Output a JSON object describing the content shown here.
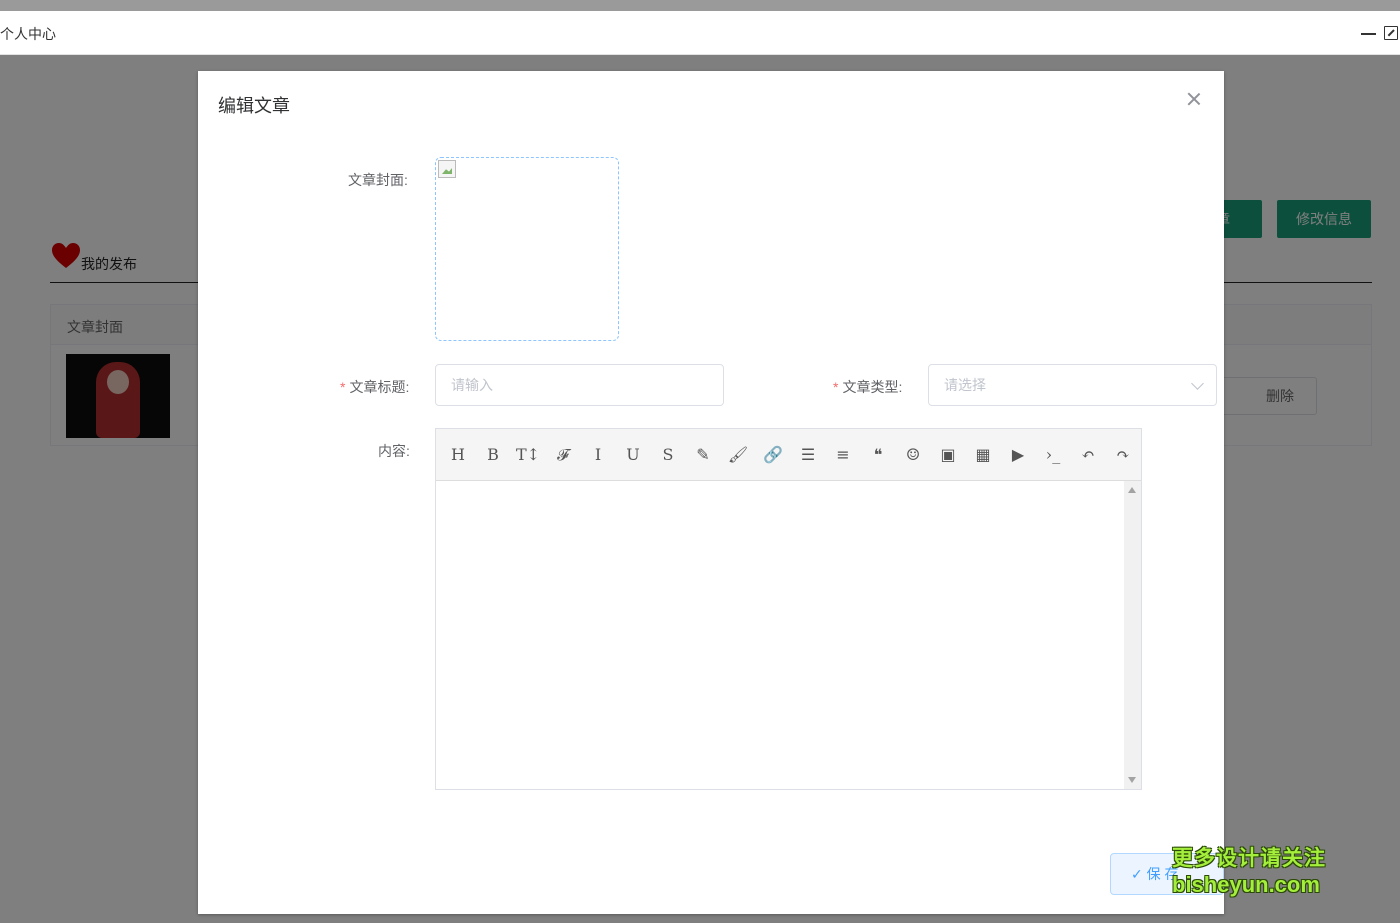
{
  "window": {
    "title": "个人中心"
  },
  "background": {
    "section_title": "我的发布",
    "buttons": {
      "publish": "文章",
      "edit_info": "修改信息"
    },
    "table": {
      "columns": [
        "文章封面"
      ],
      "delete_label": "删除"
    }
  },
  "dialog": {
    "title": "编辑文章",
    "labels": {
      "cover": "文章封面:",
      "title": "文章标题:",
      "type": "文章类型:",
      "content": "内容:"
    },
    "title_input": {
      "placeholder": "请输入",
      "value": ""
    },
    "type_select": {
      "placeholder": "请选择",
      "value": ""
    },
    "editor": {
      "toolbar": [
        {
          "glyph": "H",
          "name": "heading-icon"
        },
        {
          "glyph": "B",
          "name": "bold-icon"
        },
        {
          "glyph": "T↕",
          "name": "font-size-icon"
        },
        {
          "glyph": "𝓕",
          "name": "font-family-icon"
        },
        {
          "glyph": "I",
          "name": "italic-icon"
        },
        {
          "glyph": "U",
          "name": "underline-icon"
        },
        {
          "glyph": "S",
          "name": "strikethrough-icon"
        },
        {
          "glyph": "✎",
          "name": "font-color-icon"
        },
        {
          "glyph": "🖌",
          "name": "background-color-icon"
        },
        {
          "glyph": "🔗",
          "name": "link-icon"
        },
        {
          "glyph": "☰",
          "name": "list-icon"
        },
        {
          "glyph": "≡",
          "name": "align-icon"
        },
        {
          "glyph": "❝",
          "name": "quote-icon"
        },
        {
          "glyph": "☺",
          "name": "emoji-icon"
        },
        {
          "glyph": "▣",
          "name": "image-icon"
        },
        {
          "glyph": "▦",
          "name": "table-icon"
        },
        {
          "glyph": "▶",
          "name": "video-icon"
        },
        {
          "glyph": "›_",
          "name": "code-icon"
        },
        {
          "glyph": "↶",
          "name": "undo-icon"
        },
        {
          "glyph": "↷",
          "name": "redo-icon"
        }
      ]
    },
    "save_label": "保 存"
  },
  "watermark": {
    "line1": "更多设计请关注",
    "line2": "bisheyun.com"
  }
}
